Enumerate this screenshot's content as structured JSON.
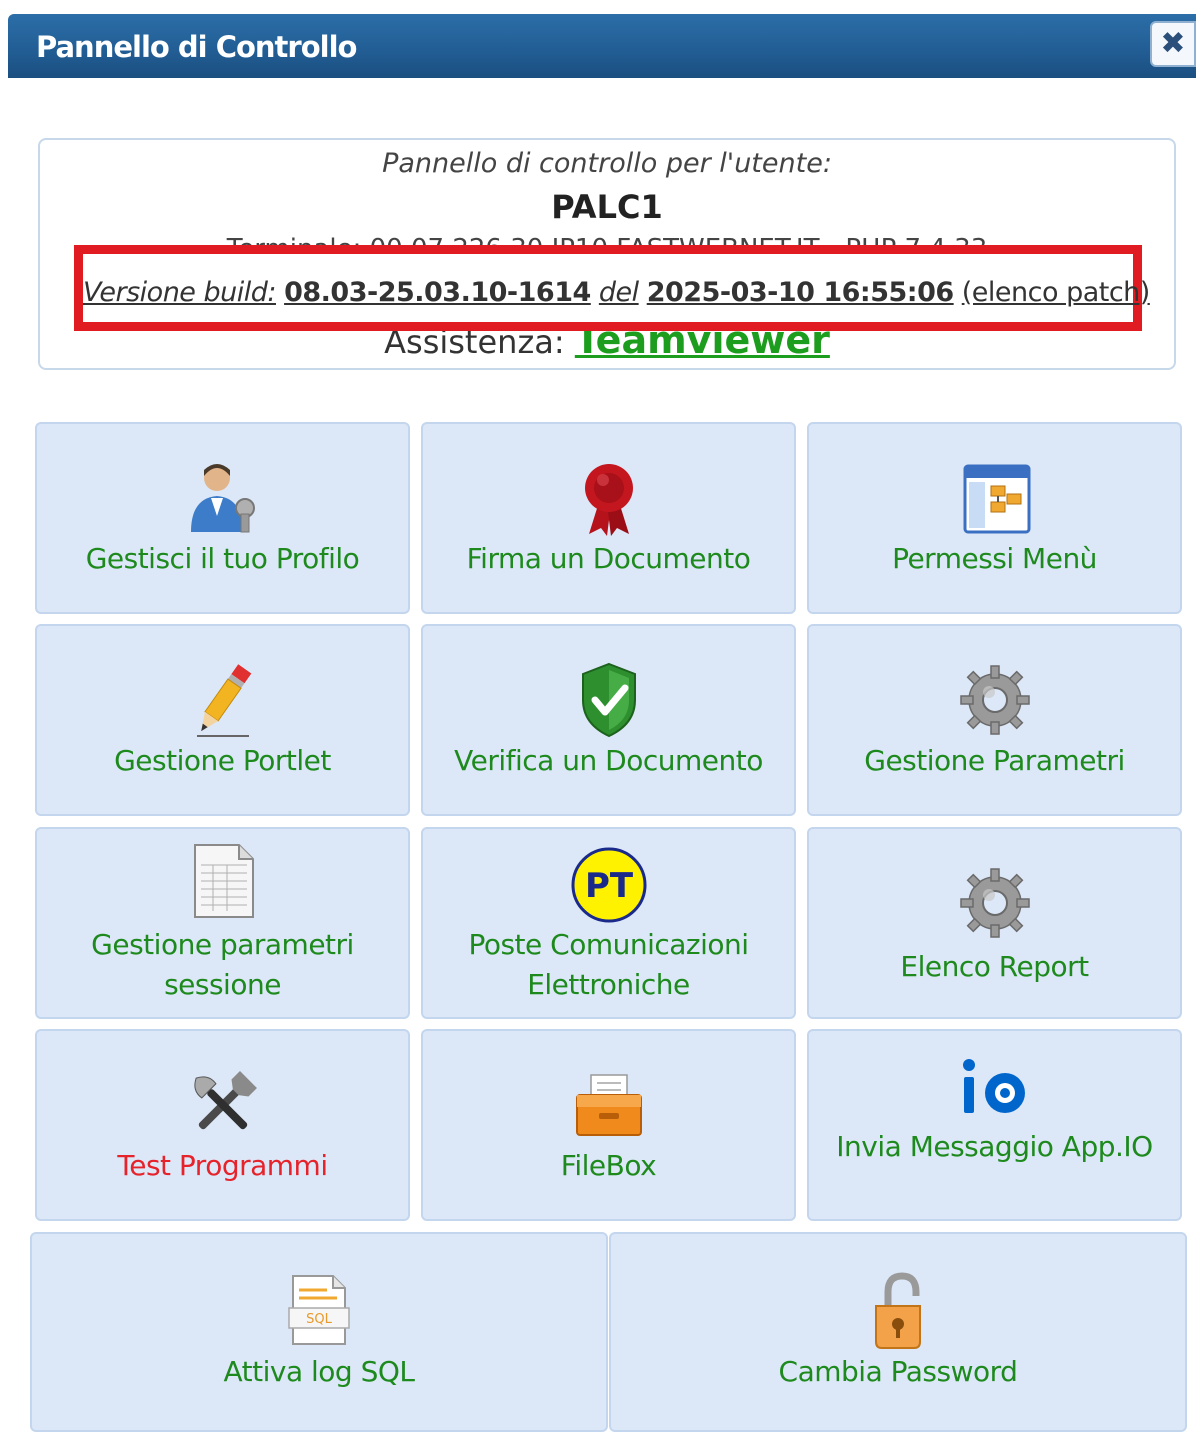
{
  "window": {
    "title": "Pannello di Controllo",
    "close_symbol": "✖"
  },
  "info": {
    "caption": "Pannello di controllo per l'utente:",
    "user": "PALC1",
    "terminal": "Terminale: 00.07.226.30 IP10.FASTWEBNET.IT - PHP 7.4.33",
    "build_label": "Versione build:",
    "build_version": "08.03-25.03.10-1614",
    "build_del": "del",
    "build_date": "2025-03-10 16:55:06",
    "patch_link": "(elenco patch)",
    "assist_label": "Assistenza:",
    "assist_link": "Teamviewer"
  },
  "tiles": [
    {
      "label": "Gestisci il tuo Profilo",
      "icon": "user-profile-icon"
    },
    {
      "label": "Firma un Documento",
      "icon": "red-seal-icon"
    },
    {
      "label": "Permessi Menù",
      "icon": "menu-permissions-icon"
    },
    {
      "label": "Gestione Portlet",
      "icon": "pencil-icon"
    },
    {
      "label": "Verifica un Documento",
      "icon": "green-shield-check-icon"
    },
    {
      "label": "Gestione Parametri",
      "icon": "gear-icon"
    },
    {
      "label": "Gestione parametri sessione",
      "icon": "spreadsheet-icon"
    },
    {
      "label": "Poste Comunicazioni Elettroniche",
      "icon": "pt-logo-icon",
      "icon_text": "PT"
    },
    {
      "label": "Elenco Report",
      "icon": "gear-icon"
    },
    {
      "label": "Test Programmi",
      "icon": "tools-icon"
    },
    {
      "label": "FileBox",
      "icon": "file-box-icon"
    },
    {
      "label": "Invia Messaggio App.IO",
      "icon": "app-io-icon"
    },
    {
      "label": "Attiva log SQL",
      "icon": "sql-log-icon",
      "icon_text": "SQL"
    },
    {
      "label": "Cambia Password",
      "icon": "open-padlock-icon"
    }
  ],
  "colors": {
    "accent_green": "#1e8a1e",
    "test_red": "#e6232b",
    "highlight_red": "#e11b22",
    "tile_bg": "#dce8f8",
    "titlebar_blue": "#225e95"
  }
}
